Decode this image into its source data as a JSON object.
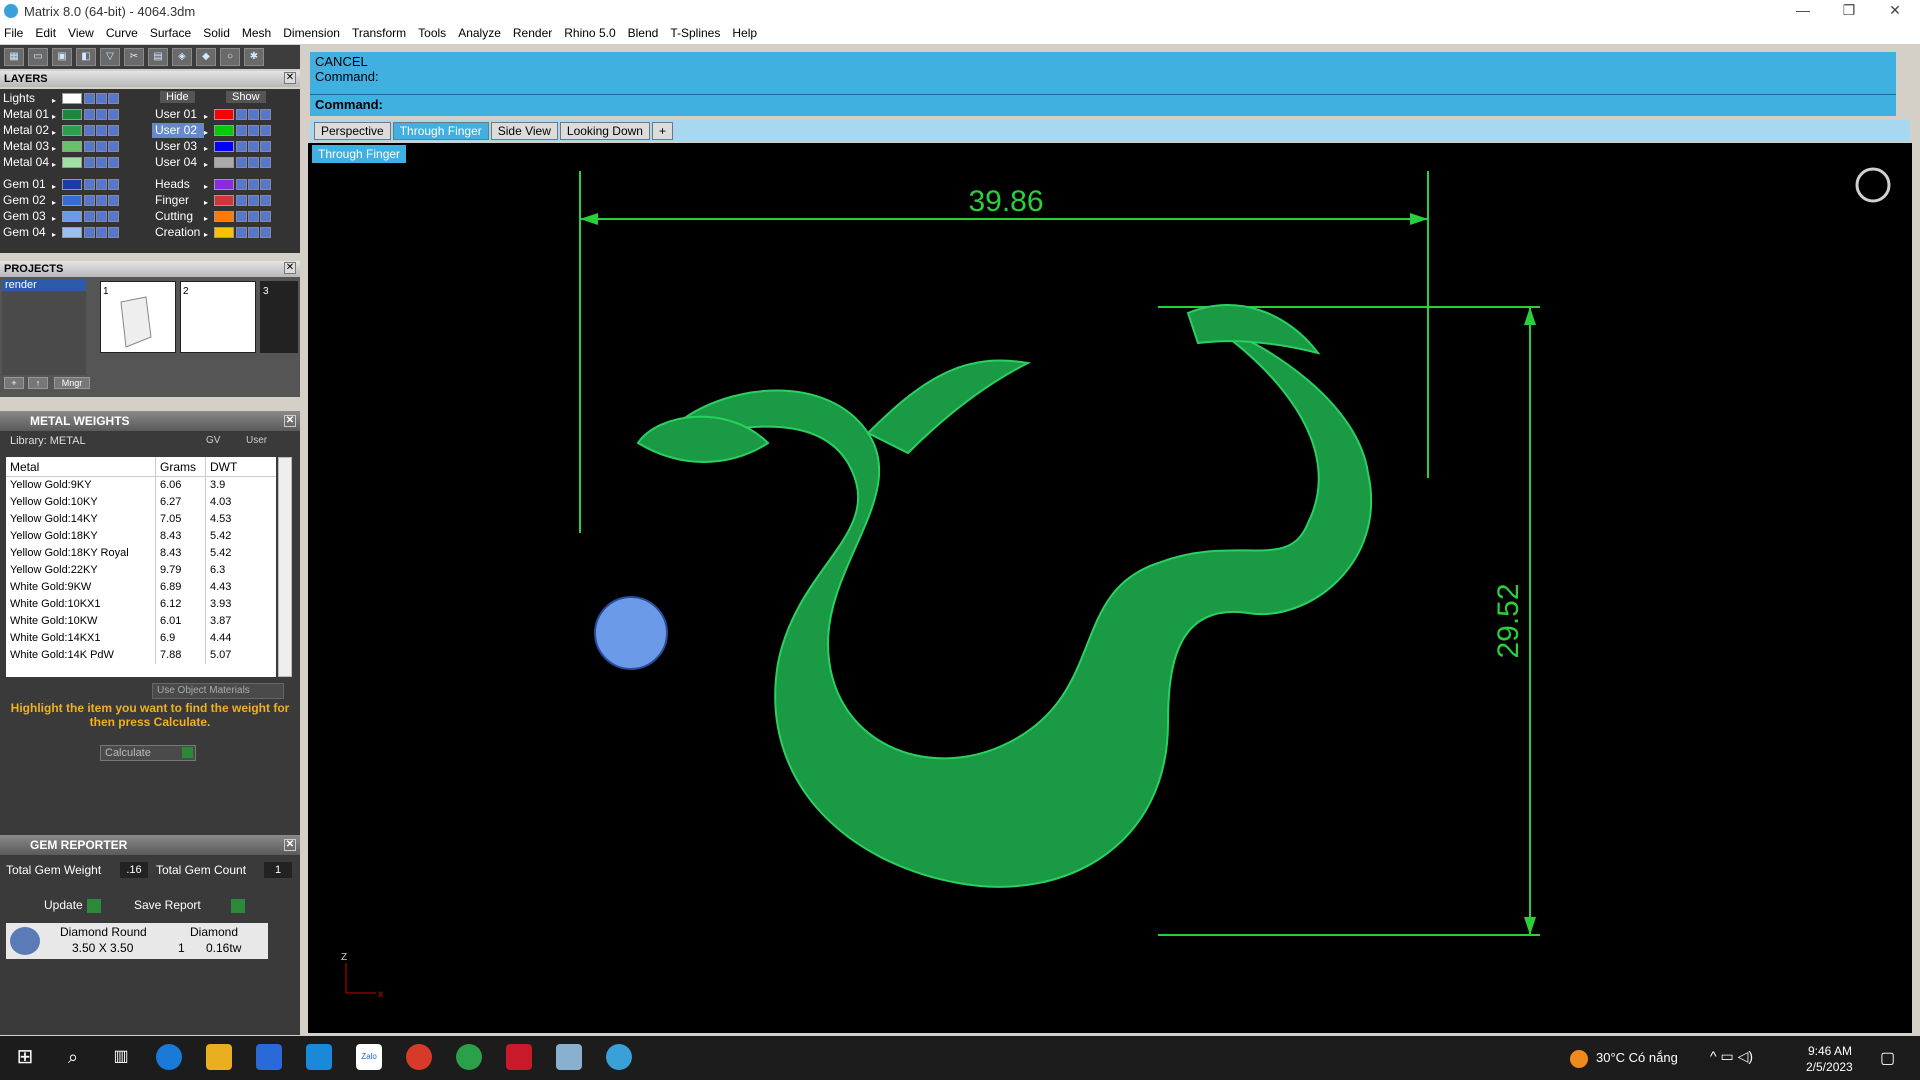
{
  "window": {
    "title": "Matrix 8.0 (64-bit) - 4064.3dm",
    "minimize": "—",
    "maximize": "❐",
    "close": "✕"
  },
  "menu": [
    "File",
    "Edit",
    "View",
    "Curve",
    "Surface",
    "Solid",
    "Mesh",
    "Dimension",
    "Transform",
    "Tools",
    "Analyze",
    "Render",
    "Rhino 5.0",
    "Blend",
    "T-Splines",
    "Help"
  ],
  "layers": {
    "title": "LAYERS",
    "hide_label": "Hide",
    "show_label": "Show",
    "left": [
      {
        "name": "Lights",
        "color": "#ffffff"
      },
      {
        "name": "Metal 01",
        "color": "#1a8a3a"
      },
      {
        "name": "Metal 02",
        "color": "#2aa04a"
      },
      {
        "name": "Metal 03",
        "color": "#6ac06a"
      },
      {
        "name": "Metal 04",
        "color": "#a0e0a0"
      },
      {
        "name": "Gem 01",
        "color": "#1a3aa8"
      },
      {
        "name": "Gem 02",
        "color": "#3a6ad8"
      },
      {
        "name": "Gem 03",
        "color": "#6a9ae8"
      },
      {
        "name": "Gem 04",
        "color": "#9ac0f0"
      }
    ],
    "right": [
      {
        "name": "User 01",
        "color": "#ff0000"
      },
      {
        "name": "User 02",
        "color": "#00cc00"
      },
      {
        "name": "User 03",
        "color": "#0000ff"
      },
      {
        "name": "User 04",
        "color": "#aaaaaa"
      },
      {
        "name": "Heads",
        "color": "#8a2ad8"
      },
      {
        "name": "Finger",
        "color": "#c83a3a"
      },
      {
        "name": "Cutting",
        "color": "#ff7a00"
      },
      {
        "name": "Creation",
        "color": "#ffc000"
      }
    ]
  },
  "projects": {
    "title": "PROJECTS",
    "items": [
      "render"
    ],
    "thumbs": [
      "1",
      "2",
      "3"
    ],
    "mngr": "Mngr"
  },
  "metal_weights": {
    "title": "METAL WEIGHTS",
    "library": "Library: METAL",
    "gv": "GV",
    "user": "User",
    "columns": [
      "Metal",
      "Grams",
      "DWT"
    ],
    "rows": [
      [
        "Yellow Gold:9KY",
        "6.06",
        "3.9"
      ],
      [
        "Yellow Gold:10KY",
        "6.27",
        "4.03"
      ],
      [
        "Yellow Gold:14KY",
        "7.05",
        "4.53"
      ],
      [
        "Yellow Gold:18KY",
        "8.43",
        "5.42"
      ],
      [
        "Yellow Gold:18KY Royal",
        "8.43",
        "5.42"
      ],
      [
        "Yellow Gold:22KY",
        "9.79",
        "6.3"
      ],
      [
        "White Gold:9KW",
        "6.89",
        "4.43"
      ],
      [
        "White Gold:10KX1",
        "6.12",
        "3.93"
      ],
      [
        "White Gold:10KW",
        "6.01",
        "3.87"
      ],
      [
        "White Gold:14KX1",
        "6.9",
        "4.44"
      ],
      [
        "White Gold:14K PdW",
        "7.88",
        "5.07"
      ]
    ],
    "use_object": "Use Object Materials",
    "hint": "Highlight the item you want to find the weight for then press Calculate.",
    "calculate": "Calculate"
  },
  "gem_reporter": {
    "title": "GEM REPORTER",
    "total_weight_label": "Total Gem Weight",
    "total_weight": ".16",
    "total_count_label": "Total Gem Count",
    "total_count": "1",
    "update": "Update",
    "save_report": "Save Report",
    "gem": {
      "shape": "Diamond Round",
      "size": "3.50 X 3.50",
      "type": "Diamond",
      "count": "1",
      "weight": "0.16tw"
    }
  },
  "command": {
    "line1": "CANCEL",
    "line2": "Command:",
    "prompt": "Command:"
  },
  "viewtabs": [
    "Perspective",
    "Through Finger",
    "Side View",
    "Looking Down",
    "+"
  ],
  "active_tab": "Through Finger",
  "viewport": {
    "label": "Through Finger",
    "dim_width": "39.86",
    "dim_height": "29.52",
    "axis_z": "Z",
    "axis_x": "x"
  },
  "taskbar": {
    "weather": "30°C Có nắng",
    "time": "9:46 AM",
    "date": "2/5/2023",
    "zalo": "Zalo"
  }
}
